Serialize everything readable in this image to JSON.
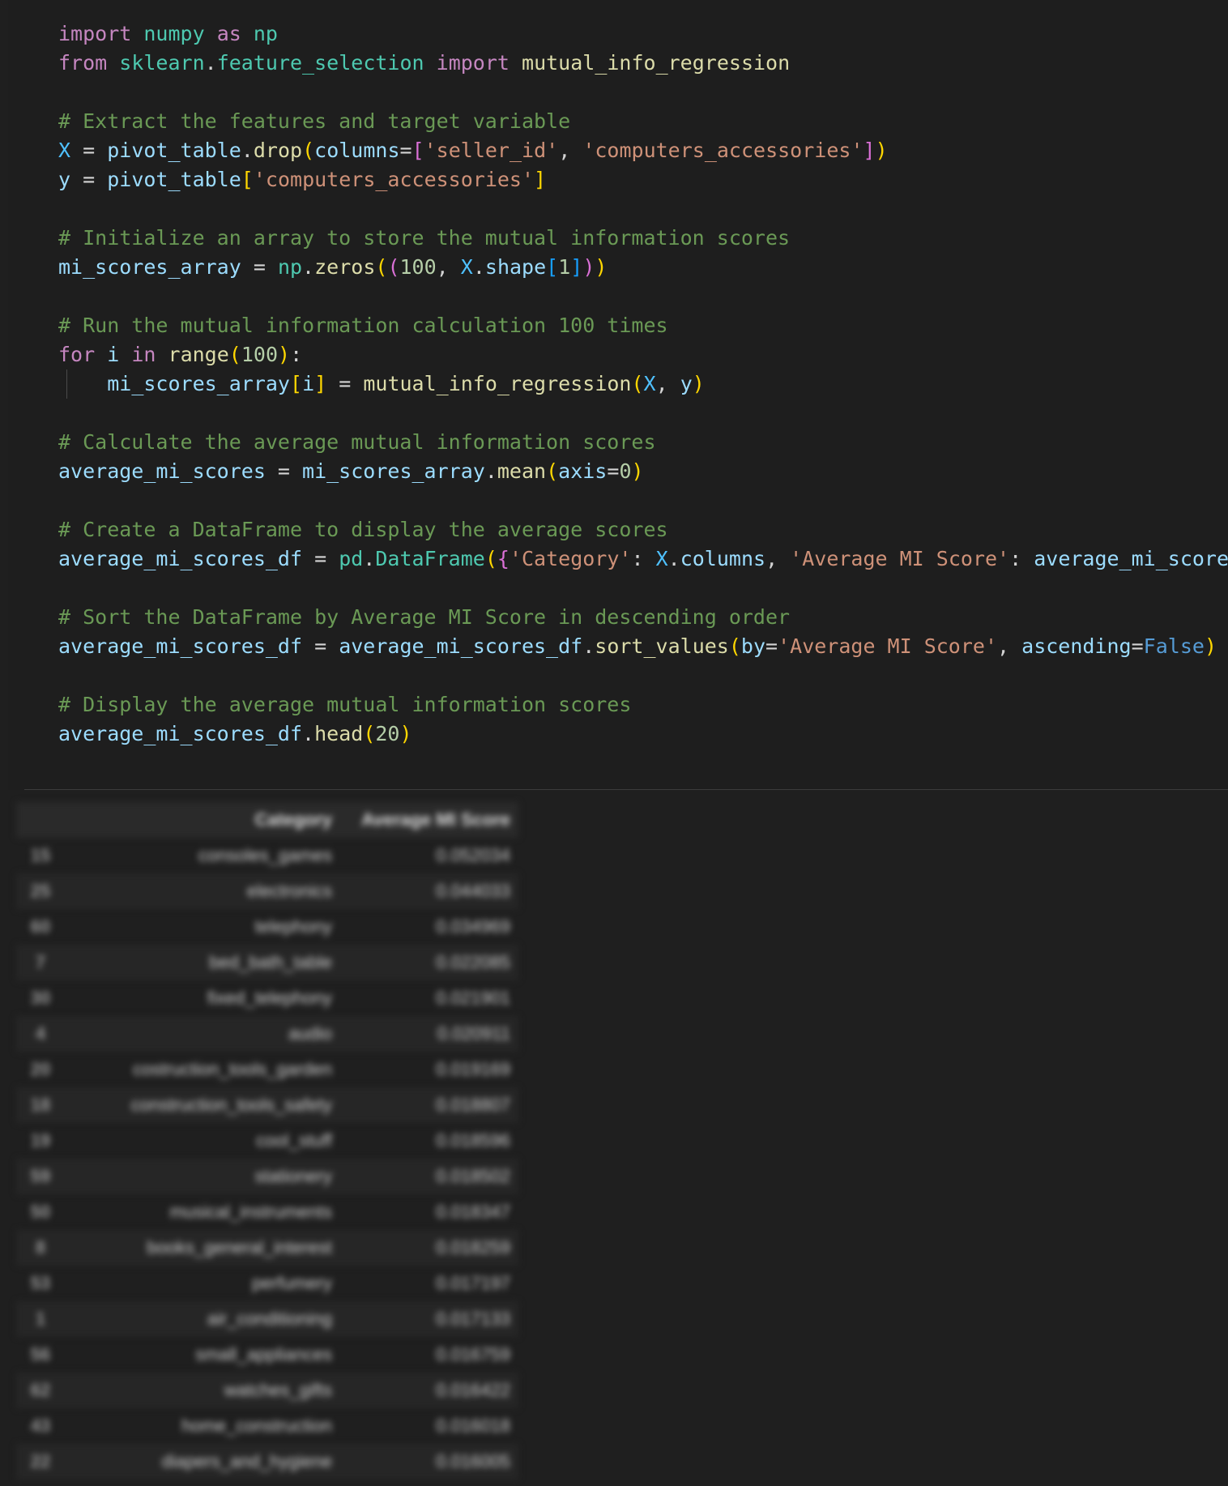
{
  "code_lines": [
    [
      {
        "t": "import",
        "c": "kw"
      },
      {
        "t": " ",
        "c": "op"
      },
      {
        "t": "numpy",
        "c": "mod"
      },
      {
        "t": " ",
        "c": "op"
      },
      {
        "t": "as",
        "c": "kw"
      },
      {
        "t": " ",
        "c": "op"
      },
      {
        "t": "np",
        "c": "mod"
      }
    ],
    [
      {
        "t": "from",
        "c": "kw"
      },
      {
        "t": " ",
        "c": "op"
      },
      {
        "t": "sklearn",
        "c": "mod"
      },
      {
        "t": ".",
        "c": "op"
      },
      {
        "t": "feature_selection",
        "c": "mod"
      },
      {
        "t": " ",
        "c": "op"
      },
      {
        "t": "import",
        "c": "kw"
      },
      {
        "t": " ",
        "c": "op"
      },
      {
        "t": "mutual_info_regression",
        "c": "fn"
      }
    ],
    [],
    [
      {
        "t": "# Extract the features and target variable",
        "c": "cmt"
      }
    ],
    [
      {
        "t": "X",
        "c": "cls"
      },
      {
        "t": " = ",
        "c": "op"
      },
      {
        "t": "pivot_table",
        "c": "var"
      },
      {
        "t": ".",
        "c": "op"
      },
      {
        "t": "drop",
        "c": "fn"
      },
      {
        "t": "(",
        "c": "b1"
      },
      {
        "t": "columns",
        "c": "var"
      },
      {
        "t": "=",
        "c": "op"
      },
      {
        "t": "[",
        "c": "b2"
      },
      {
        "t": "'seller_id'",
        "c": "str"
      },
      {
        "t": ", ",
        "c": "op"
      },
      {
        "t": "'computers_accessories'",
        "c": "str"
      },
      {
        "t": "]",
        "c": "b2"
      },
      {
        "t": ")",
        "c": "b1"
      }
    ],
    [
      {
        "t": "y",
        "c": "var"
      },
      {
        "t": " = ",
        "c": "op"
      },
      {
        "t": "pivot_table",
        "c": "var"
      },
      {
        "t": "[",
        "c": "b1"
      },
      {
        "t": "'computers_accessories'",
        "c": "str"
      },
      {
        "t": "]",
        "c": "b1"
      }
    ],
    [],
    [
      {
        "t": "# Initialize an array to store the mutual information scores",
        "c": "cmt"
      }
    ],
    [
      {
        "t": "mi_scores_array",
        "c": "var"
      },
      {
        "t": " = ",
        "c": "op"
      },
      {
        "t": "np",
        "c": "mod"
      },
      {
        "t": ".",
        "c": "op"
      },
      {
        "t": "zeros",
        "c": "fn"
      },
      {
        "t": "(",
        "c": "b1"
      },
      {
        "t": "(",
        "c": "b2"
      },
      {
        "t": "100",
        "c": "num"
      },
      {
        "t": ", ",
        "c": "op"
      },
      {
        "t": "X",
        "c": "cls"
      },
      {
        "t": ".",
        "c": "op"
      },
      {
        "t": "shape",
        "c": "var"
      },
      {
        "t": "[",
        "c": "b3"
      },
      {
        "t": "1",
        "c": "num"
      },
      {
        "t": "]",
        "c": "b3"
      },
      {
        "t": ")",
        "c": "b2"
      },
      {
        "t": ")",
        "c": "b1"
      }
    ],
    [],
    [
      {
        "t": "# Run the mutual information calculation 100 times",
        "c": "cmt"
      }
    ],
    [
      {
        "t": "for",
        "c": "kw"
      },
      {
        "t": " ",
        "c": "op"
      },
      {
        "t": "i",
        "c": "var"
      },
      {
        "t": " ",
        "c": "op"
      },
      {
        "t": "in",
        "c": "kw"
      },
      {
        "t": " ",
        "c": "op"
      },
      {
        "t": "range",
        "c": "fn"
      },
      {
        "t": "(",
        "c": "b1"
      },
      {
        "t": "100",
        "c": "num"
      },
      {
        "t": ")",
        "c": "b1"
      },
      {
        "t": ":",
        "c": "op"
      }
    ],
    [
      {
        "t": "    ",
        "c": "op"
      },
      {
        "t": "mi_scores_array",
        "c": "var"
      },
      {
        "t": "[",
        "c": "b1"
      },
      {
        "t": "i",
        "c": "var"
      },
      {
        "t": "]",
        "c": "b1"
      },
      {
        "t": " = ",
        "c": "op"
      },
      {
        "t": "mutual_info_regression",
        "c": "fn"
      },
      {
        "t": "(",
        "c": "b1"
      },
      {
        "t": "X",
        "c": "cls"
      },
      {
        "t": ", ",
        "c": "op"
      },
      {
        "t": "y",
        "c": "var"
      },
      {
        "t": ")",
        "c": "b1"
      }
    ],
    [],
    [
      {
        "t": "# Calculate the average mutual information scores",
        "c": "cmt"
      }
    ],
    [
      {
        "t": "average_mi_scores",
        "c": "var"
      },
      {
        "t": " = ",
        "c": "op"
      },
      {
        "t": "mi_scores_array",
        "c": "var"
      },
      {
        "t": ".",
        "c": "op"
      },
      {
        "t": "mean",
        "c": "fn"
      },
      {
        "t": "(",
        "c": "b1"
      },
      {
        "t": "axis",
        "c": "var"
      },
      {
        "t": "=",
        "c": "op"
      },
      {
        "t": "0",
        "c": "num"
      },
      {
        "t": ")",
        "c": "b1"
      }
    ],
    [],
    [
      {
        "t": "# Create a DataFrame to display the average scores",
        "c": "cmt"
      }
    ],
    [
      {
        "t": "average_mi_scores_df",
        "c": "var"
      },
      {
        "t": " = ",
        "c": "op"
      },
      {
        "t": "pd",
        "c": "mod"
      },
      {
        "t": ".",
        "c": "op"
      },
      {
        "t": "DataFrame",
        "c": "mod"
      },
      {
        "t": "(",
        "c": "b1"
      },
      {
        "t": "{",
        "c": "b2"
      },
      {
        "t": "'Category'",
        "c": "str"
      },
      {
        "t": ": ",
        "c": "op"
      },
      {
        "t": "X",
        "c": "cls"
      },
      {
        "t": ".",
        "c": "op"
      },
      {
        "t": "columns",
        "c": "var"
      },
      {
        "t": ", ",
        "c": "op"
      },
      {
        "t": "'Average MI Score'",
        "c": "str"
      },
      {
        "t": ": ",
        "c": "op"
      },
      {
        "t": "average_mi_scores",
        "c": "var"
      },
      {
        "t": "}",
        "c": "b2"
      },
      {
        "t": ")",
        "c": "b1"
      }
    ],
    [],
    [
      {
        "t": "# Sort the DataFrame by Average MI Score in descending order",
        "c": "cmt"
      }
    ],
    [
      {
        "t": "average_mi_scores_df",
        "c": "var"
      },
      {
        "t": " = ",
        "c": "op"
      },
      {
        "t": "average_mi_scores_df",
        "c": "var"
      },
      {
        "t": ".",
        "c": "op"
      },
      {
        "t": "sort_values",
        "c": "fn"
      },
      {
        "t": "(",
        "c": "b1"
      },
      {
        "t": "by",
        "c": "var"
      },
      {
        "t": "=",
        "c": "op"
      },
      {
        "t": "'Average MI Score'",
        "c": "str"
      },
      {
        "t": ", ",
        "c": "op"
      },
      {
        "t": "ascending",
        "c": "var"
      },
      {
        "t": "=",
        "c": "op"
      },
      {
        "t": "False",
        "c": "bool"
      },
      {
        "t": ")",
        "c": "b1"
      }
    ],
    [],
    [
      {
        "t": "# Display the average mutual information scores",
        "c": "cmt"
      }
    ],
    [
      {
        "t": "average_mi_scores_df",
        "c": "var"
      },
      {
        "t": ".",
        "c": "op"
      },
      {
        "t": "head",
        "c": "fn"
      },
      {
        "t": "(",
        "c": "b1"
      },
      {
        "t": "20",
        "c": "num"
      },
      {
        "t": ")",
        "c": "b1"
      }
    ]
  ],
  "output_table": {
    "columns": [
      "",
      "Category",
      "Average MI Score"
    ],
    "rows": [
      [
        "15",
        "consoles_games",
        "0.052034"
      ],
      [
        "25",
        "electronics",
        "0.044033"
      ],
      [
        "60",
        "telephony",
        "0.034969"
      ],
      [
        "7",
        "bed_bath_table",
        "0.022085"
      ],
      [
        "30",
        "fixed_telephony",
        "0.021901"
      ],
      [
        "4",
        "audio",
        "0.020911"
      ],
      [
        "20",
        "costruction_tools_garden",
        "0.019169"
      ],
      [
        "18",
        "construction_tools_safety",
        "0.018807"
      ],
      [
        "19",
        "cool_stuff",
        "0.018596"
      ],
      [
        "59",
        "stationery",
        "0.018502"
      ],
      [
        "50",
        "musical_instruments",
        "0.018347"
      ],
      [
        "8",
        "books_general_interest",
        "0.018259"
      ],
      [
        "53",
        "perfumery",
        "0.017197"
      ],
      [
        "1",
        "air_conditioning",
        "0.017133"
      ],
      [
        "56",
        "small_appliances",
        "0.016759"
      ],
      [
        "62",
        "watches_gifts",
        "0.016422"
      ],
      [
        "43",
        "home_construction",
        "0.016018"
      ],
      [
        "22",
        "diapers_and_hygiene",
        "0.016005"
      ]
    ]
  }
}
